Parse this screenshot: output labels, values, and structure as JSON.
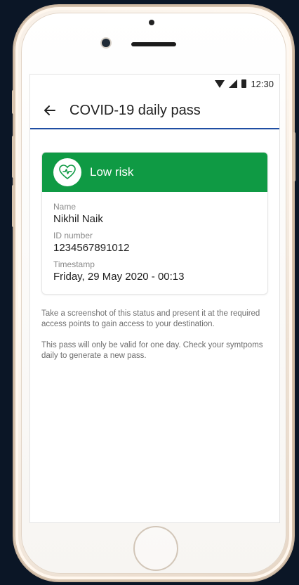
{
  "status_bar": {
    "time": "12:30",
    "icons": [
      "wifi-icon",
      "signal-icon",
      "battery-icon"
    ]
  },
  "appbar": {
    "back_icon": "arrow-left-icon",
    "title": "COVID-19 daily pass"
  },
  "pass_card": {
    "status_label": "Low risk",
    "status_color": "#0f9a44",
    "status_icon": "heart-pulse-icon",
    "fields": [
      {
        "label": "Name",
        "value": "Nikhil Naik"
      },
      {
        "label": "ID number",
        "value": "1234567891012"
      },
      {
        "label": "Timestamp",
        "value": "Friday, 29 May 2020 - 00:13"
      }
    ]
  },
  "instructions": [
    "Take a screenshot of this status and present it at the required access points to gain access to your destination.",
    "This pass will only be valid for one day. Check your symtpoms daily to generate a new pass."
  ],
  "colors": {
    "accent": "#1f4ea3",
    "success": "#0f9a44",
    "background": "#0b1626"
  }
}
